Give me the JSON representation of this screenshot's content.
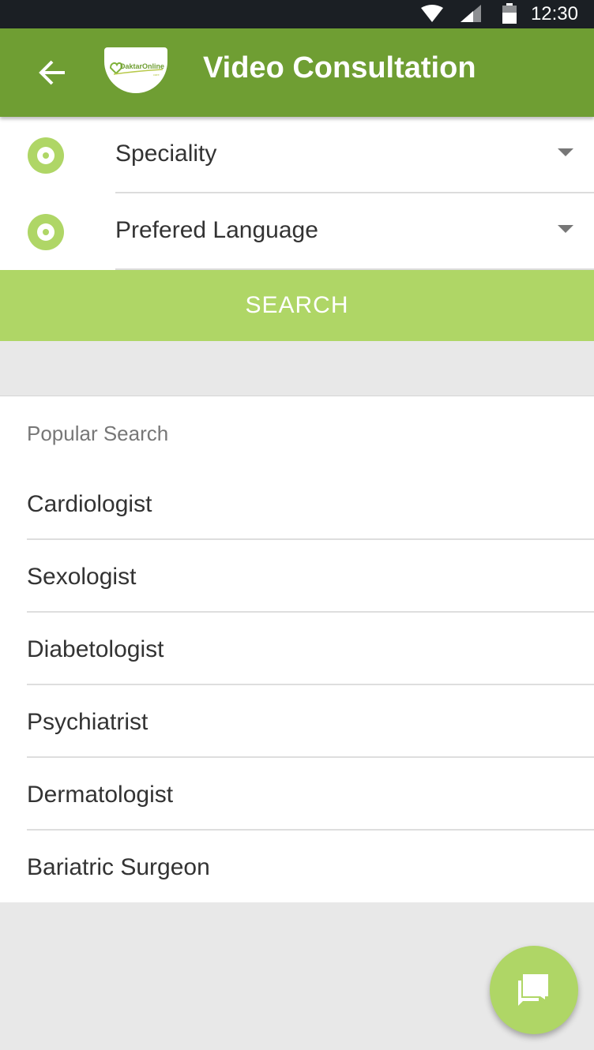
{
  "status_bar": {
    "time": "12:30",
    "icons": [
      "wifi-icon",
      "cell-signal-icon",
      "battery-icon"
    ]
  },
  "app_bar": {
    "title": "Video Consultation",
    "back_icon": "arrow-back-icon",
    "logo_text": "DaktarOnline",
    "color": "#6f9e33"
  },
  "form": {
    "speciality_label": "Speciality",
    "language_label": "Prefered Language",
    "accent_color": "#afd666"
  },
  "search_button": {
    "label": "SEARCH"
  },
  "popular": {
    "heading": "Popular Search",
    "items": [
      "Cardiologist",
      "Sexologist",
      "Diabetologist",
      "Psychiatrist",
      "Dermatologist",
      "Bariatric Surgeon"
    ]
  },
  "fab": {
    "icon": "chat-icon"
  }
}
